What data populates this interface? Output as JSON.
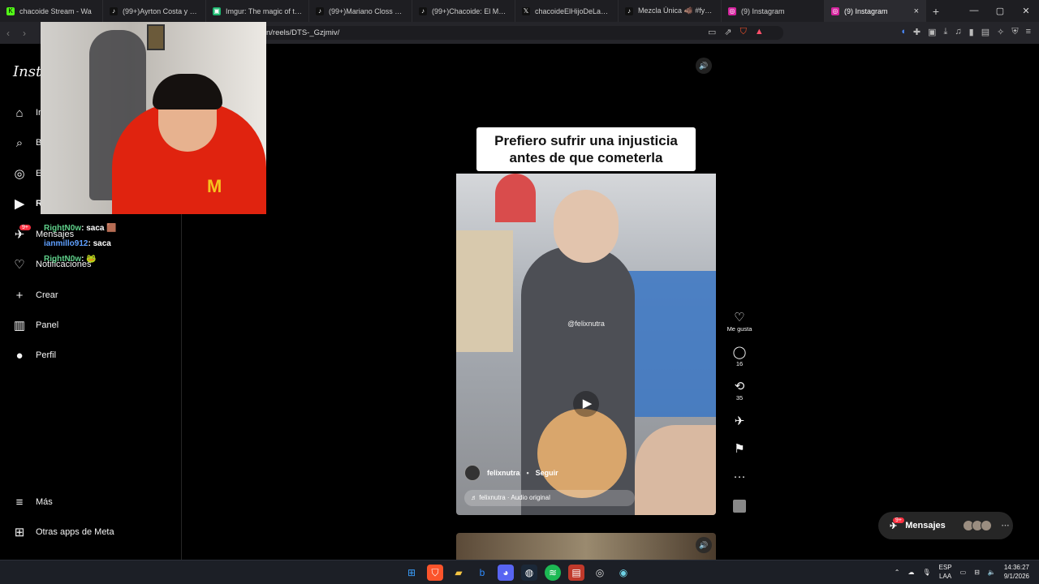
{
  "browser": {
    "tabs": [
      {
        "title": "chacoide Stream - Wa",
        "fav_color": "#53fc18",
        "fav_glyph": "K"
      },
      {
        "title": "(99+)Ayrton Costa y Salas",
        "fav_color": "#111111",
        "fav_glyph": "♪"
      },
      {
        "title": "Imgur: The magic of the In",
        "fav_color": "#1bb76e",
        "fav_glyph": "▣"
      },
      {
        "title": "(99+)Mariano Closs Narra",
        "fav_color": "#111111",
        "fav_glyph": "♪"
      },
      {
        "title": "(99+)Chacoide: El Mejor St",
        "fav_color": "#111111",
        "fav_glyph": "♪"
      },
      {
        "title": "chacoideElHijoDeLaGranP",
        "fav_color": "#111111",
        "fav_glyph": "𝕏"
      },
      {
        "title": "Mezcla Única 🐗 #fyp #d",
        "fav_color": "#111111",
        "fav_glyph": "♪"
      },
      {
        "title": "(9) Instagram",
        "fav_color": "#d6249f",
        "fav_glyph": "◎"
      },
      {
        "title": "(9) Instagram",
        "fav_color": "#d6249f",
        "fav_glyph": "◎"
      }
    ],
    "new_tab": "+",
    "window_controls": [
      "—",
      "▢",
      "✕"
    ],
    "url": "n/reels/DTS-_Gzjmiv/"
  },
  "sidebar": {
    "logo": "Insta",
    "items": [
      {
        "label": "In",
        "icon": "home-icon",
        "glyph": "⌂"
      },
      {
        "label": "B",
        "icon": "search-icon",
        "glyph": "⌕"
      },
      {
        "label": "E",
        "icon": "explore-icon",
        "glyph": "◎"
      },
      {
        "label": "R",
        "icon": "reels-icon",
        "glyph": "▶"
      },
      {
        "label": "Mensajes",
        "icon": "messenger-icon",
        "glyph": "✈"
      },
      {
        "label": "Notificaciones",
        "icon": "heart-icon",
        "glyph": "♡"
      },
      {
        "label": "Crear",
        "icon": "plus-icon",
        "glyph": "+"
      },
      {
        "label": "Panel",
        "icon": "dashboard-icon",
        "glyph": "▥"
      },
      {
        "label": "Perfil",
        "icon": "profile-icon",
        "glyph": "●"
      }
    ],
    "messages_badge": "9+",
    "more": "Más",
    "meta_apps": "Otras apps de Meta"
  },
  "chat": [
    {
      "user": "RightN0w",
      "text": ": saca",
      "emote": "🟫"
    },
    {
      "user": "ianmillo912",
      "text": ": saca",
      "emote": ""
    },
    {
      "user": "RightN0w",
      "text": ":",
      "emote": "🐸"
    }
  ],
  "reel": {
    "caption_line1": "Prefiero sufrir una injusticia",
    "caption_line2": "antes de que cometerla",
    "watermark": "@felixnutra",
    "author": "felixnutra",
    "follow": "Seguir",
    "audio": "felixnutra · Audio original"
  },
  "actions": {
    "like_label": "Me gusta",
    "comments": "16",
    "reposts": "35"
  },
  "messages_pill": {
    "label": "Mensajes",
    "badge": "9+"
  },
  "taskbar": {
    "lang_top": "ESP",
    "lang_bottom": "LAA",
    "time": "14:36:27",
    "date": "9/1/2026"
  }
}
